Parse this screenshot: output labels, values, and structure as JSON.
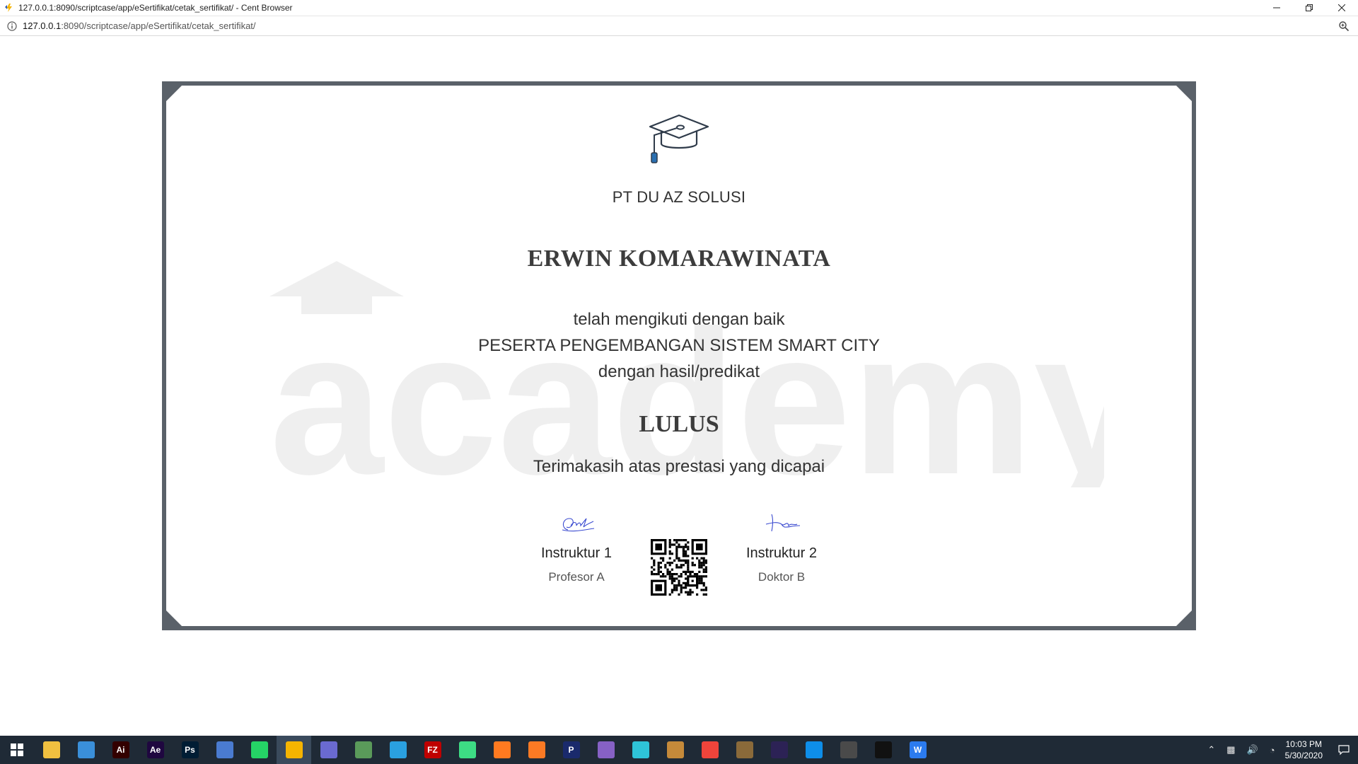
{
  "window": {
    "title": "127.0.0.1:8090/scriptcase/app/eSertifikat/cetak_sertifikat/ - Cent Browser",
    "controls": [
      "minimize",
      "restore",
      "close"
    ]
  },
  "address_bar": {
    "url_host": "127.0.0.1",
    "url_rest": ":8090/scriptcase/app/eSertifikat/cetak_sertifikat/"
  },
  "certificate": {
    "company": "PT DU AZ SOLUSI",
    "recipient": "ERWIN KOMARAWINATA",
    "line1": "telah mengikuti dengan baik",
    "program": "PESERTA PENGEMBANGAN SISTEM SMART CITY",
    "line3": "dengan hasil/predikat",
    "grade": "LULUS",
    "thanks": "Terimakasih atas prestasi yang dicapai",
    "watermark": "academy",
    "signers": [
      {
        "title": "Instruktur 1",
        "name": "Profesor A"
      },
      {
        "title": "Instruktur 2",
        "name": "Doktor B"
      }
    ],
    "frame_color": "#5a6169"
  },
  "taskbar": {
    "apps": [
      {
        "name": "file-explorer-icon",
        "label": "",
        "color": "#f0c040"
      },
      {
        "name": "control-panel-icon",
        "label": "",
        "color": "#3a8fd9"
      },
      {
        "name": "illustrator-icon",
        "label": "Ai",
        "color": "#330000"
      },
      {
        "name": "after-effects-icon",
        "label": "Ae",
        "color": "#1f0740"
      },
      {
        "name": "photoshop-icon",
        "label": "Ps",
        "color": "#001d34"
      },
      {
        "name": "network-tool-icon",
        "label": "",
        "color": "#4a7bd0"
      },
      {
        "name": "whatsapp-icon",
        "label": "",
        "color": "#25d366"
      },
      {
        "name": "cent-browser-icon",
        "label": "",
        "color": "#f5b400"
      },
      {
        "name": "admin-tool-icon",
        "label": "",
        "color": "#6a6ad0"
      },
      {
        "name": "app-manager-icon",
        "label": "",
        "color": "#5a9a5a"
      },
      {
        "name": "browser-alt-icon",
        "label": "",
        "color": "#2aa0e0"
      },
      {
        "name": "filezilla-icon",
        "label": "FZ",
        "color": "#bf0000"
      },
      {
        "name": "android-studio-icon",
        "label": "",
        "color": "#3ddc84"
      },
      {
        "name": "sublime-icon",
        "label": "",
        "color": "#ff7a20"
      },
      {
        "name": "xampp-icon",
        "label": "",
        "color": "#fb7a24"
      },
      {
        "name": "p-app-icon",
        "label": "P",
        "color": "#1a2a6c"
      },
      {
        "name": "visual-studio-icon",
        "label": "",
        "color": "#8661c5"
      },
      {
        "name": "design-app-icon",
        "label": "",
        "color": "#2ec4d8"
      },
      {
        "name": "game-icon",
        "label": "",
        "color": "#c58a3a"
      },
      {
        "name": "anydesk-icon",
        "label": "",
        "color": "#ef443b"
      },
      {
        "name": "game-alt-icon",
        "label": "",
        "color": "#8a6a3a"
      },
      {
        "name": "eclipse-icon",
        "label": "",
        "color": "#2c2255"
      },
      {
        "name": "teamviewer-icon",
        "label": "",
        "color": "#0e8ee9"
      },
      {
        "name": "globe-tool-icon",
        "label": "",
        "color": "#4a4a4a"
      },
      {
        "name": "terminal-icon",
        "label": "",
        "color": "#111111"
      },
      {
        "name": "wps-writer-icon",
        "label": "W",
        "color": "#2b7bef"
      }
    ],
    "clock_time": "10:03 PM",
    "clock_date": "5/30/2020"
  }
}
